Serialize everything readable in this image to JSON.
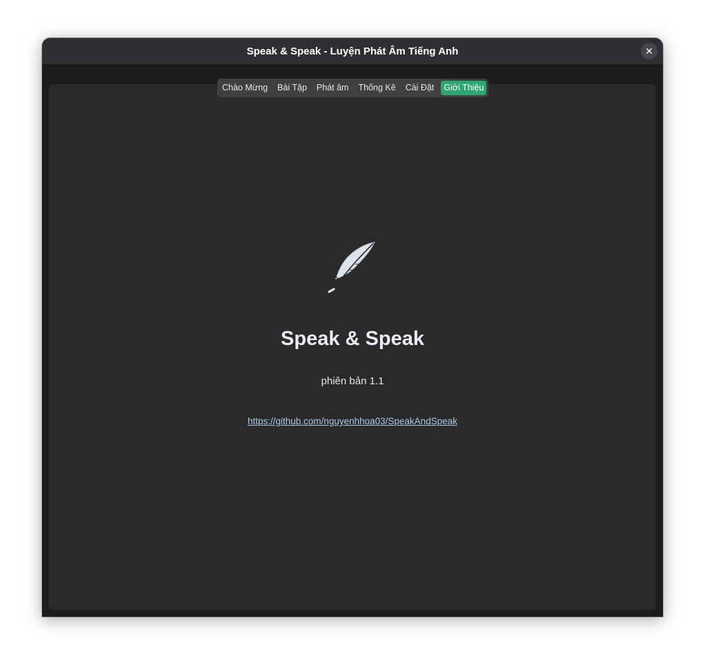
{
  "window": {
    "title": "Speak & Speak - Luyện Phát Âm Tiếng Anh",
    "close_glyph": "✕"
  },
  "tabs": [
    {
      "label": "Chào Mừng",
      "active": false
    },
    {
      "label": "Bài Tập",
      "active": false
    },
    {
      "label": "Phát âm",
      "active": false
    },
    {
      "label": "Thống Kê",
      "active": false
    },
    {
      "label": "Cài Đặt",
      "active": false
    },
    {
      "label": "Giới Thiệu",
      "active": true
    }
  ],
  "about": {
    "logo_icon": "feather-icon",
    "app_name": "Speak & Speak",
    "version": "phiên bản 1.1",
    "link": "https://github.com/nguyenhhoa03/SpeakAndSpeak"
  },
  "colors": {
    "accent": "#2ea66f",
    "window_bg": "#1c1c1c",
    "content_bg": "#2a2a2a",
    "titlebar_bg": "#2f2f33",
    "link": "#a8c8ea"
  }
}
